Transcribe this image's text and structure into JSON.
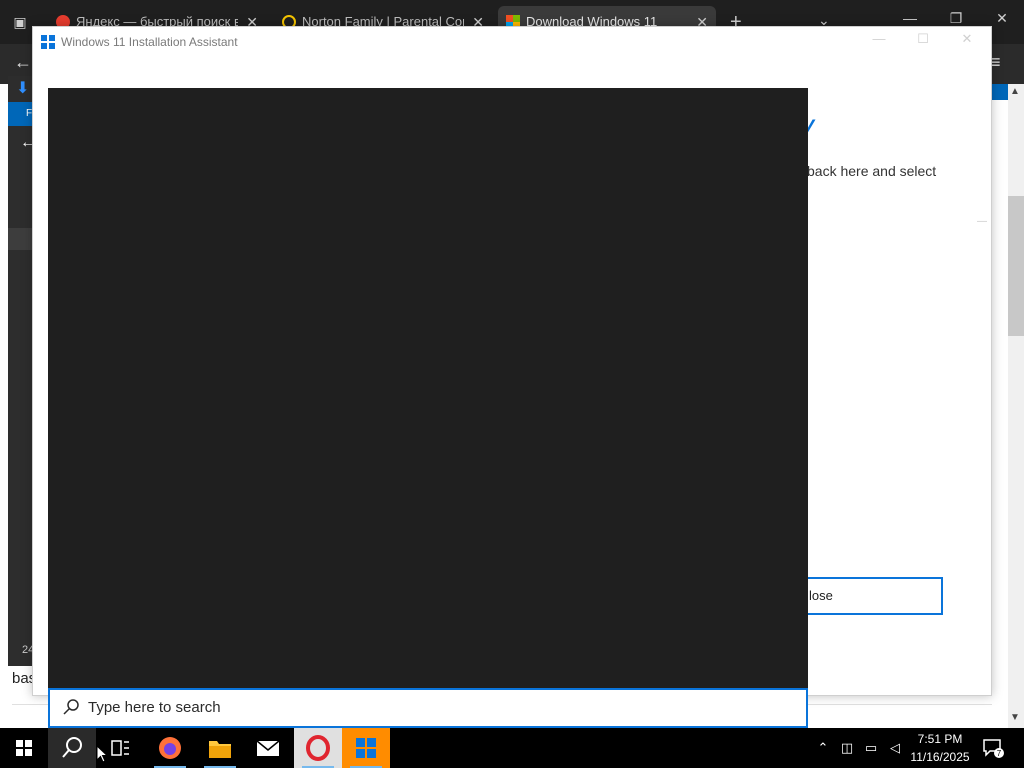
{
  "browser": {
    "tabs": [
      {
        "title": "Яндекс — быстрый поиск в ин",
        "favicon_color": "#e63c2e",
        "active": false
      },
      {
        "title": "Norton Family | Parental Contr",
        "favicon_color": "#f5c400",
        "active": false
      },
      {
        "title": "Download Windows 11",
        "favicon_color": "#7cbb00",
        "active": true
      }
    ],
    "new_tab_glyph": "+",
    "page_left_label": "F",
    "page_left_number": "24",
    "page_bottom_text": "bas"
  },
  "assistant": {
    "title": "Windows 11 Installation Assistant",
    "heading_fragment": "y",
    "body_fragment": "back here and select",
    "close_button_label": "lose"
  },
  "search": {
    "placeholder": "Type here to search"
  },
  "taskbar": {
    "apps": [
      "start",
      "search",
      "task-view",
      "firefox",
      "file-explorer",
      "mail",
      "opera",
      "windows-11-installation-assistant"
    ],
    "clock": {
      "time": "7:51 PM",
      "date": "11/16/2025"
    },
    "notification_count": "7"
  },
  "colors": {
    "accent": "#0a74da",
    "taskbar": "#000000",
    "search_panel": "#1f1f1f"
  }
}
